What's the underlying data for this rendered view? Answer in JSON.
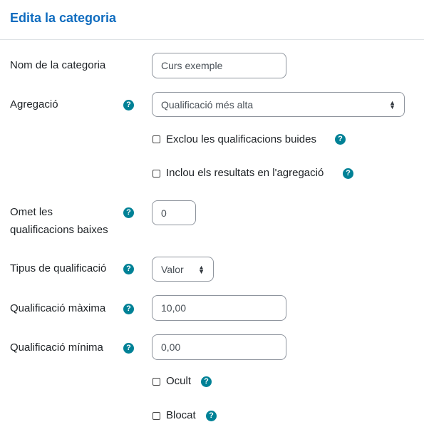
{
  "page": {
    "title": "Edita la categoria"
  },
  "form": {
    "name": {
      "label": "Nom de la categoria",
      "placeholder": "Curs exemple"
    },
    "aggregation": {
      "label": "Agregació",
      "value": "Qualificació més alta"
    },
    "exclude_empty": {
      "label": "Exclou les qualificacions buides",
      "checked": false
    },
    "include_outcomes": {
      "label": "Inclou els resultats en l'agregació",
      "checked": false
    },
    "drop_lowest": {
      "label_line1": "Omet les",
      "label_line2": "qualificacions baixes",
      "value": "0"
    },
    "grade_type": {
      "label": "Tipus de qualificació",
      "value": "Valor"
    },
    "max_grade": {
      "label": "Qualificació màxima",
      "value": "10,00"
    },
    "min_grade": {
      "label": "Qualificació mínima",
      "value": "0,00"
    },
    "hidden": {
      "label": "Ocult",
      "checked": false
    },
    "locked": {
      "label": "Blocat",
      "checked": false
    }
  },
  "icons": {
    "help": "question-circle-icon",
    "select_arrow": "sort-arrows-icon"
  },
  "colors": {
    "title": "#0f6cbf",
    "help_icon": "#008196",
    "border": "#8f959e"
  }
}
